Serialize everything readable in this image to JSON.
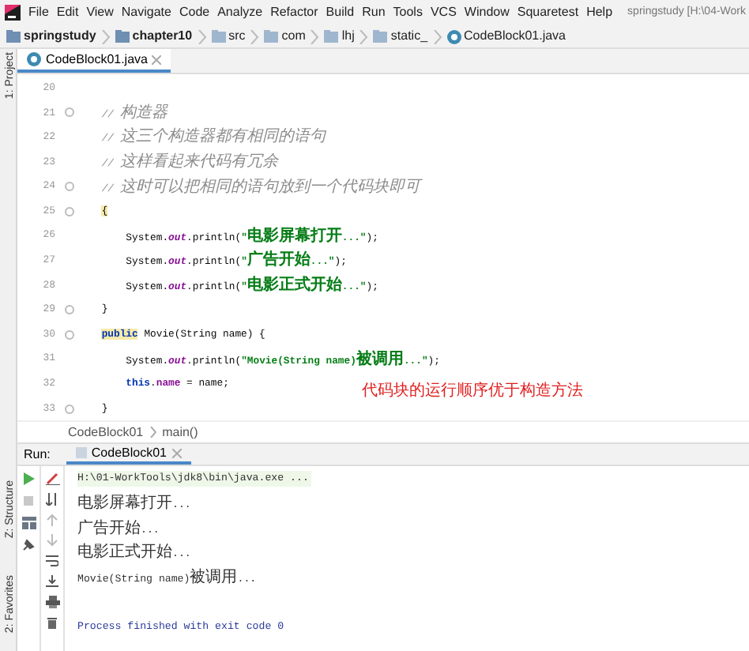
{
  "menu_bar": {
    "items": [
      "File",
      "Edit",
      "View",
      "Navigate",
      "Code",
      "Analyze",
      "Refactor",
      "Build",
      "Run",
      "Tools",
      "VCS",
      "Window",
      "Squaretest",
      "Help"
    ],
    "title": "springstudy [H:\\04-Work"
  },
  "breadcrumb": [
    {
      "kind": "module",
      "label": "springstudy"
    },
    {
      "kind": "module",
      "label": "chapter10"
    },
    {
      "kind": "folder",
      "label": "src"
    },
    {
      "kind": "folder",
      "label": "com"
    },
    {
      "kind": "folder",
      "label": "lhj"
    },
    {
      "kind": "folder",
      "label": "static_"
    },
    {
      "kind": "class",
      "label": "CodeBlock01.java"
    }
  ],
  "editor_tabs": [
    {
      "label": "CodeBlock01.java",
      "selected": true
    }
  ],
  "side_tools": [
    {
      "label": "1: Project"
    },
    {
      "label": "Z: Structure"
    },
    {
      "label": "2: Favorites"
    }
  ],
  "editor": {
    "lines": [
      {
        "number": "20",
        "fold": false
      },
      {
        "number": "21",
        "fold": true,
        "tokens": [
          {
            "kind": "comment",
            "text": "    // 构造器"
          }
        ]
      },
      {
        "number": "22",
        "fold": false,
        "tokens": [
          {
            "kind": "comment",
            "text": "    // 这三个构造器都有相同的语句"
          }
        ]
      },
      {
        "number": "23",
        "fold": false,
        "tokens": [
          {
            "kind": "comment",
            "text": "    // 这样看起来代码有冗余"
          }
        ]
      },
      {
        "number": "24",
        "fold": true,
        "tokens": [
          {
            "kind": "comment",
            "text": "    // 这时可以把相同的语句放到一个代码块即可"
          }
        ]
      },
      {
        "number": "25",
        "fold": true,
        "tokens": [
          {
            "kind": "plain",
            "text": "    {",
            "highlighted": true
          }
        ]
      },
      {
        "number": "26",
        "fold": false,
        "tokens": [
          {
            "kind": "plain",
            "text": "        System."
          },
          {
            "kind": "field",
            "text": "out"
          },
          {
            "kind": "plain",
            "text": ".println("
          },
          {
            "kind": "string",
            "text": "\"电影屏幕打开...\""
          },
          {
            "kind": "plain",
            "text": ");"
          }
        ]
      },
      {
        "number": "27",
        "fold": false,
        "tokens": [
          {
            "kind": "plain",
            "text": "        System."
          },
          {
            "kind": "field",
            "text": "out"
          },
          {
            "kind": "plain",
            "text": ".println("
          },
          {
            "kind": "string",
            "text": "\"广告开始...\""
          },
          {
            "kind": "plain",
            "text": ");"
          }
        ]
      },
      {
        "number": "28",
        "fold": false,
        "tokens": [
          {
            "kind": "plain",
            "text": "        System."
          },
          {
            "kind": "field",
            "text": "out"
          },
          {
            "kind": "plain",
            "text": ".println("
          },
          {
            "kind": "string",
            "text": "\"电影正式开始...\""
          },
          {
            "kind": "plain",
            "text": ");"
          }
        ]
      },
      {
        "number": "29",
        "fold": true,
        "tokens": [
          {
            "kind": "plain",
            "text": "    }"
          }
        ]
      },
      {
        "number": "30",
        "fold": true,
        "tokens": [
          {
            "kind": "keyword",
            "text": "    public",
            "highlighted": true
          },
          {
            "kind": "plain",
            "text": " Movie(String name) {"
          }
        ]
      },
      {
        "number": "31",
        "fold": false,
        "tokens": [
          {
            "kind": "plain",
            "text": "        System."
          },
          {
            "kind": "field",
            "text": "out"
          },
          {
            "kind": "plain",
            "text": ".println("
          },
          {
            "kind": "string",
            "text": "\"Movie(String name)被调用...\""
          },
          {
            "kind": "plain",
            "text": ");"
          }
        ]
      },
      {
        "number": "32",
        "fold": false,
        "tokens": [
          {
            "kind": "keyword",
            "text": "        this"
          },
          {
            "kind": "plain",
            "text": "."
          },
          {
            "kind": "field_bold",
            "text": "name"
          },
          {
            "kind": "plain",
            "text": " = name;"
          }
        ]
      },
      {
        "number": "33",
        "fold": true,
        "tokens": [
          {
            "kind": "plain",
            "text": "    }"
          }
        ]
      }
    ],
    "annotation": "代码块的运行顺序优于构造方法"
  },
  "editor_breadcrumb": [
    "CodeBlock01",
    "main()"
  ],
  "run_panel": {
    "label": "Run:",
    "tabs": [
      {
        "label": "CodeBlock01",
        "selected": true
      }
    ],
    "console": [
      {
        "kind": "command",
        "text": "H:\\01-WorkTools\\jdk8\\bin\\java.exe ..."
      },
      {
        "kind": "output",
        "text": "电影屏幕打开..."
      },
      {
        "kind": "output",
        "text": "广告开始..."
      },
      {
        "kind": "output",
        "text": "电影正式开始..."
      },
      {
        "kind": "output",
        "text": "Movie(String name)被调用..."
      },
      {
        "kind": "blank"
      },
      {
        "kind": "exit",
        "text": "Process finished with exit code 0"
      }
    ]
  }
}
